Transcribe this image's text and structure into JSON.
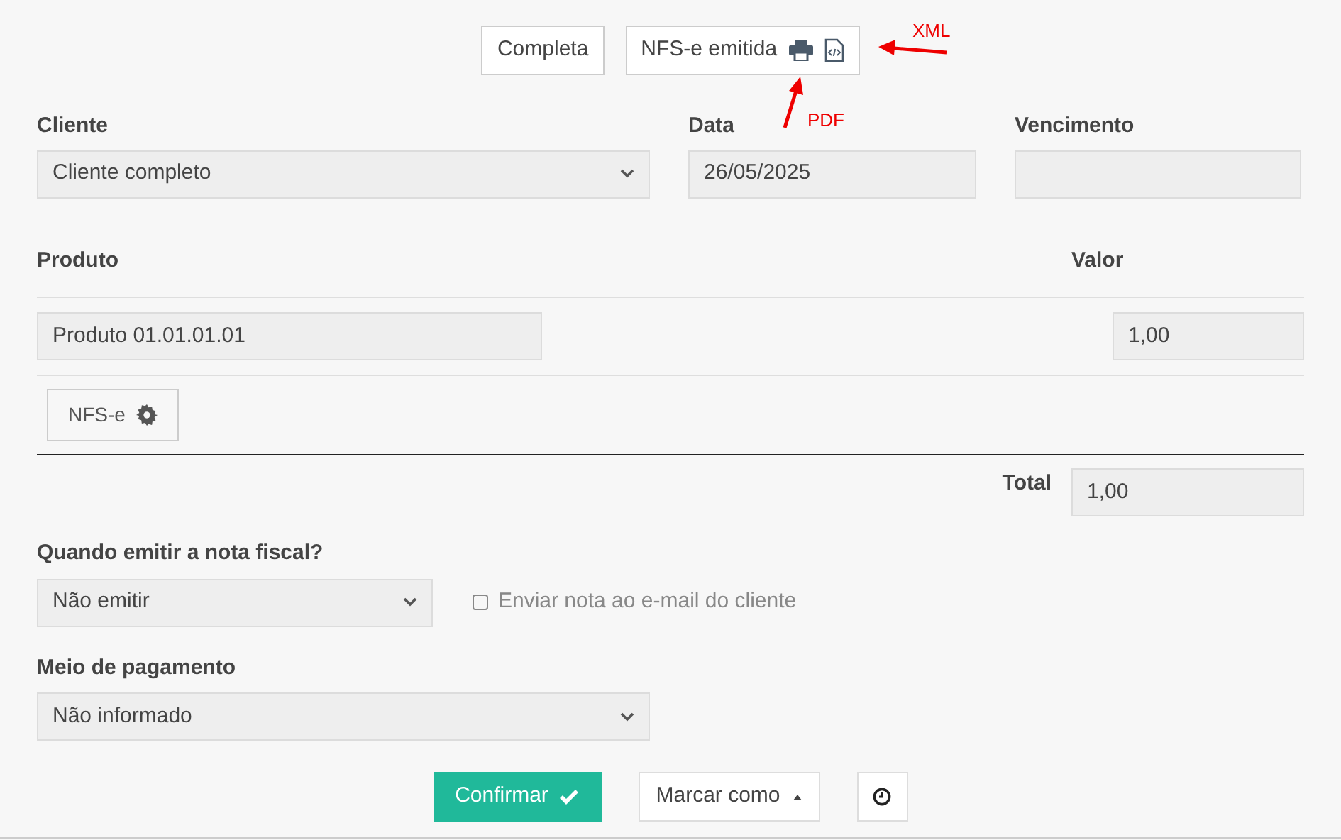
{
  "status_buttons": [
    {
      "label": "Completa"
    },
    {
      "label": "NFS-e emitida"
    }
  ],
  "annotations": [
    {
      "label": "XML"
    },
    {
      "label": "PDF"
    }
  ],
  "client": {
    "label": "Cliente",
    "value": "Cliente completo"
  },
  "date": {
    "label": "Data",
    "value": "26/05/2025"
  },
  "due": {
    "label": "Vencimento"
  },
  "items_header": {
    "product": "Produto",
    "value": "Valor"
  },
  "items": [
    {
      "product": "Produto 01.01.01.01",
      "value": "1,00"
    }
  ],
  "nfse_button": "NFS-e",
  "total": {
    "label": "Total",
    "value": "1,00"
  },
  "invoice": {
    "label": "Quando emitir a nota fiscal?",
    "value": "Não emitir"
  },
  "email_checkbox": {
    "label": "Enviar nota ao e-mail do cliente",
    "checked": false
  },
  "payment": {
    "label": "Meio de pagamento",
    "value": "Não informado"
  },
  "actions": {
    "confirm": "Confirmar",
    "mark": "Marcar como"
  }
}
